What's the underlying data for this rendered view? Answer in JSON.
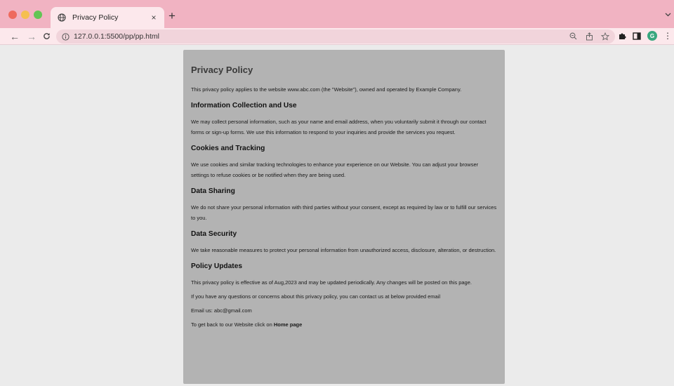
{
  "browser": {
    "tab_title": "Privacy Policy",
    "new_tab_symbol": "+",
    "close_symbol": "×",
    "url": "127.0.0.1:5500/pp/pp.html",
    "profile_initial": "G",
    "colors": {
      "tabstrip": "#f1b3c2",
      "toolbar": "#fce8ec",
      "avatar": "#39a77f"
    }
  },
  "page": {
    "title": "Privacy Policy",
    "intro": "This privacy policy applies to the website www.abc.com (the \"Website\"), owned and operated by Example Company.",
    "sections": [
      {
        "heading": "Information Collection and Use",
        "body": "We may collect personal information, such as your name and email address, when you voluntarily submit it through our contact forms or sign-up forms. We use this information to respond to your inquiries and provide the services you request."
      },
      {
        "heading": "Cookies and Tracking",
        "body": "We use cookies and similar tracking technologies to enhance your experience on our Website. You can adjust your browser settings to refuse cookies or be notified when they are being used."
      },
      {
        "heading": "Data Sharing",
        "body": "We do not share your personal information with third parties without your consent, except as required by law or to fulfill our services to you."
      },
      {
        "heading": "Data Security",
        "body": "We take reasonable measures to protect your personal information from unauthorized access, disclosure, alteration, or destruction."
      },
      {
        "heading": "Policy Updates",
        "body": "This privacy policy is effective as of Aug,2023 and may be updated periodically. Any changes will be posted on this page."
      }
    ],
    "contact_note": "If you have any questions or concerns about this privacy policy, you can contact us at below provided email",
    "email_line": "Email us: abc@gmail.com",
    "back_prefix": "To get back to our Website click on ",
    "home_link": "Home page",
    "colors": {
      "background": "#ebebeb",
      "card": "#b3b3b3"
    }
  }
}
